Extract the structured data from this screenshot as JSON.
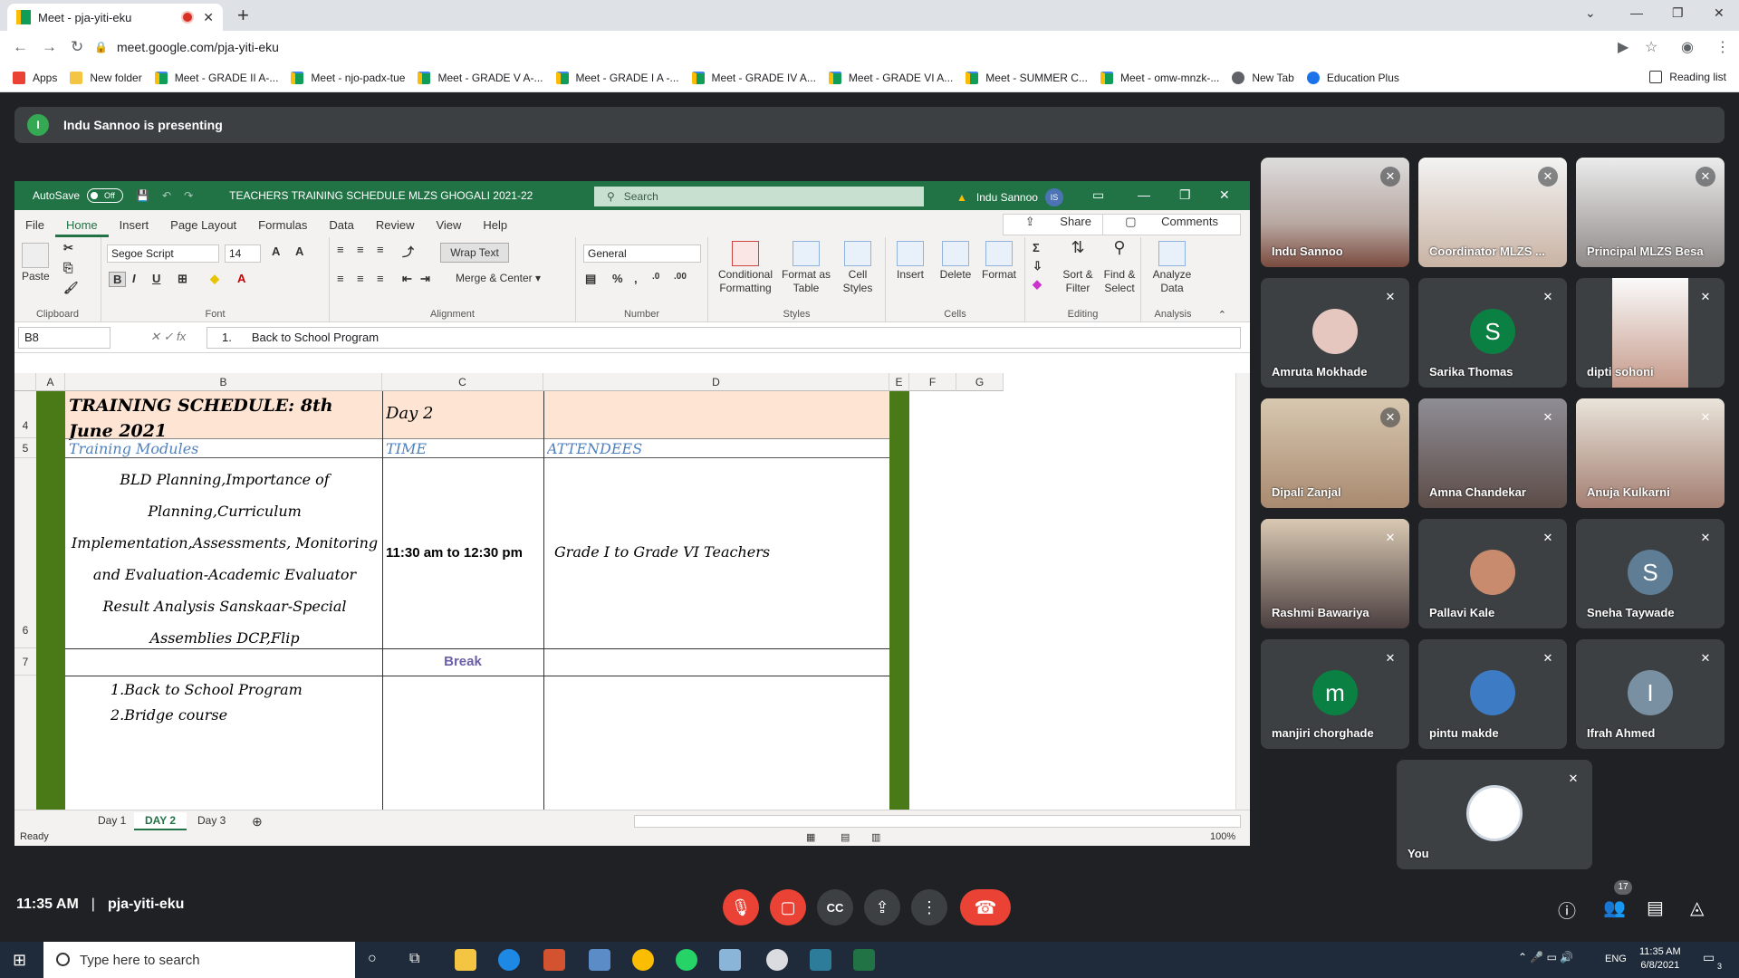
{
  "browser": {
    "tab_title": "Meet - pja-yiti-eku",
    "tab_close": "✕",
    "new_tab": "+",
    "url": "meet.google.com/pja-yiti-eku",
    "bookmarks": [
      "Apps",
      "New folder",
      "Meet - GRADE II A-...",
      "Meet - njo-padx-tue",
      "Meet - GRADE V A-...",
      "Meet - GRADE I A -...",
      "Meet - GRADE IV A...",
      "Meet - GRADE VI A...",
      "Meet - SUMMER C...",
      "Meet - omw-mnzk-...",
      "New Tab",
      "Education Plus"
    ],
    "reading_list": "Reading list"
  },
  "presenting": {
    "initial": "I",
    "text": "Indu Sannoo is presenting"
  },
  "excel": {
    "autosave": "AutoSave",
    "autosave_state": "Off",
    "doc_title": "TEACHERS TRAINING SCHEDULE MLZS GHOGALI 2021-22",
    "search": "Search",
    "user": "Indu Sannoo",
    "user_initials": "IS",
    "menu": [
      "File",
      "Home",
      "Insert",
      "Page Layout",
      "Formulas",
      "Data",
      "Review",
      "View",
      "Help"
    ],
    "share": "Share",
    "comments": "Comments",
    "ribbon": {
      "paste": "Paste",
      "font_name": "Segoe Script",
      "font_size": "14",
      "wrap_text": "Wrap Text",
      "merge_center": "Merge & Center",
      "number_format": "General",
      "conditional": "Conditional Formatting",
      "format_table": "Format as Table",
      "cell_styles": "Cell Styles",
      "insert": "Insert",
      "delete": "Delete",
      "format": "Format",
      "sort_filter": "Sort & Filter",
      "find_select": "Find & Select",
      "analyze": "Analyze Data",
      "groups": [
        "Clipboard",
        "Font",
        "Alignment",
        "Number",
        "Styles",
        "Cells",
        "Editing",
        "Analysis"
      ]
    },
    "name_box": "B8",
    "formula_prefix": "1.",
    "formula": "Back to School Program",
    "columns": [
      "A",
      "B",
      "C",
      "D",
      "E",
      "F",
      "G"
    ],
    "rows": [
      "4",
      "5",
      "6",
      "7"
    ],
    "cells": {
      "b4": "TRAINING SCHEDULE: 8th June 2021",
      "c4": "Day 2",
      "b5": "Training Modules",
      "c5": "TIME",
      "d5": "ATTENDEES",
      "b6": "BLD Planning,Importance of Planning,Curriculum Implementation,Assessments, Monitoring and Evaluation-Academic Evaluator Result Analysis Sanskaar-Special Assemblies DCP,Flip",
      "c6": "11:30 am to 12:30 pm",
      "d6": "Grade I to Grade VI Teachers",
      "c7": "Break",
      "b8a": "1.Back to School Program",
      "b8b": "2.Bridge course"
    },
    "sheets": [
      "Day 1",
      "DAY 2",
      "Day 3"
    ],
    "status": "Ready",
    "zoom": "100%"
  },
  "participants": [
    {
      "name": "Indu Sannoo"
    },
    {
      "name": "Coordinator MLZS ..."
    },
    {
      "name": "Principal MLZS Besa"
    },
    {
      "name": "Amruta Mokhade"
    },
    {
      "name": "Sarika Thomas",
      "initial": "S",
      "color": "#0b8043"
    },
    {
      "name": "dipti sohoni"
    },
    {
      "name": "Dipali Zanjal"
    },
    {
      "name": "Amna Chandekar"
    },
    {
      "name": "Anuja Kulkarni"
    },
    {
      "name": "Rashmi Bawariya"
    },
    {
      "name": "Pallavi Kale"
    },
    {
      "name": "Sneha Taywade",
      "initial": "S",
      "color": "#5f7d95"
    },
    {
      "name": "manjiri chorghade",
      "initial": "m",
      "color": "#0b8043"
    },
    {
      "name": "pintu makde"
    },
    {
      "name": "Ifrah Ahmed",
      "initial": "I",
      "color": "#7990a3"
    },
    {
      "name": "You"
    }
  ],
  "meeting": {
    "time": "11:35 AM",
    "code": "pja-yiti-eku",
    "people_count": "17"
  },
  "taskbar": {
    "search": "Type here to search",
    "lang": "ENG",
    "time": "11:35 AM",
    "date": "6/8/2021",
    "notif": "3"
  }
}
